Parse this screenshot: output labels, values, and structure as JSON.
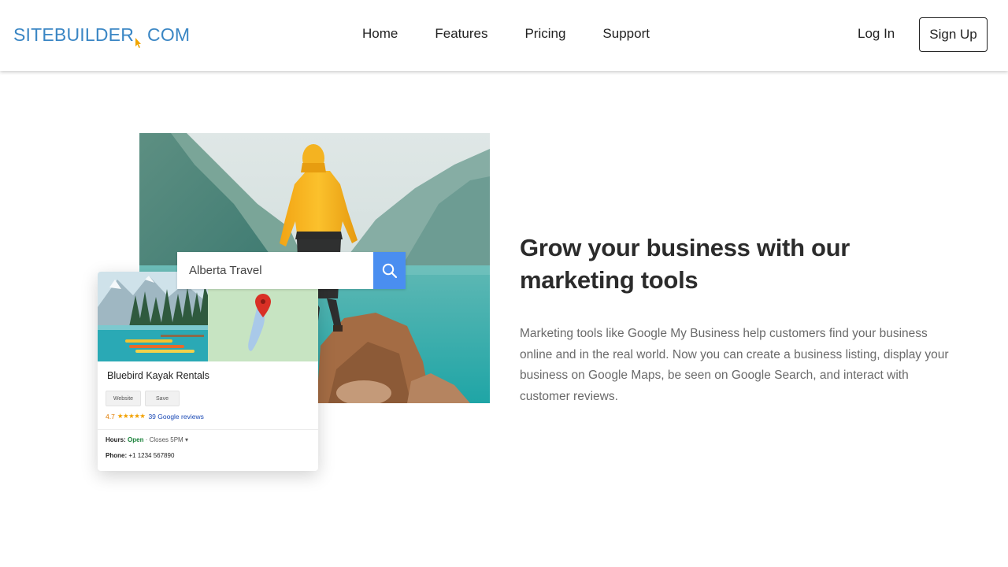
{
  "header": {
    "logo_part1": "SITEBUILDER",
    "logo_part2": "COM",
    "nav": [
      "Home",
      "Features",
      "Pricing",
      "Support"
    ],
    "login_label": "Log In",
    "signup_label": "Sign Up"
  },
  "hero": {
    "search_value": "Alberta Travel",
    "listing": {
      "name": "Bluebird Kayak Rentals",
      "website_label": "Website",
      "save_label": "Save",
      "rating": "4.7",
      "stars": "★★★★★",
      "reviews": "39 Google reviews",
      "hours_label": "Hours:",
      "hours_status": "Open",
      "hours_closes": "· Closes 5PM ▾",
      "phone_label": "Phone:",
      "phone_value": "+1 1234 567890"
    }
  },
  "copy": {
    "headline": "Grow your business with our marketing tools",
    "body": "Marketing tools like Google My Business help customers find your business online and in the real world. Now you can create a business listing, display your business on Google Maps, be seen on Google Search, and interact with customer reviews."
  },
  "colors": {
    "brand_blue": "#3a86c4",
    "search_button": "#4a8ef0",
    "open_green": "#188038",
    "star_orange": "#f2a100"
  }
}
